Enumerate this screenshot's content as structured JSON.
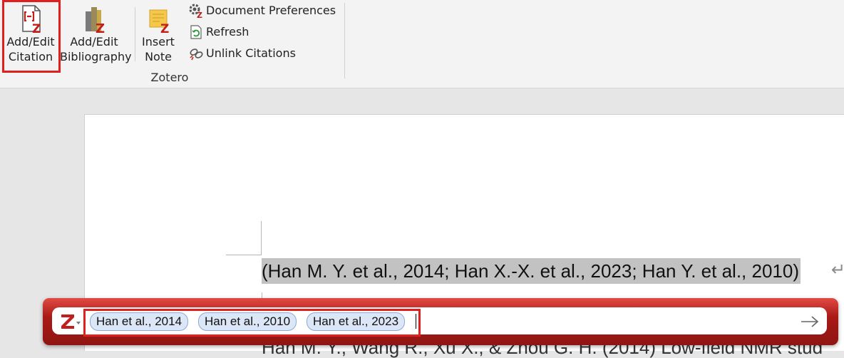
{
  "ribbon": {
    "add_edit_citation": {
      "line1": "Add/Edit",
      "line2": "Citation"
    },
    "add_edit_bibliography": {
      "line1": "Add/Edit",
      "line2": "Bibliography"
    },
    "insert_note": {
      "line1": "Insert",
      "line2": "Note"
    },
    "document_preferences": "Document Preferences",
    "refresh": "Refresh",
    "unlink_citations": "Unlink Citations",
    "group_label": "Zotero"
  },
  "document": {
    "citation_text": "(Han M. Y. et al., 2014; Han X.-X. et al., 2023; Han Y. et al., 2010)",
    "paragraph_mark": "↵",
    "reference_fragment": "Han M. Y., Wang R., Xu X., & Zhou G. H. (2014) Low-field NMR stud"
  },
  "zotero_bar": {
    "citations": [
      "Han et al., 2014",
      "Han et al., 2010",
      "Han et al., 2023"
    ],
    "colors": {
      "bar": "#b01c18",
      "highlight": "#e0201e",
      "bubble": "#dbe6f6"
    }
  }
}
